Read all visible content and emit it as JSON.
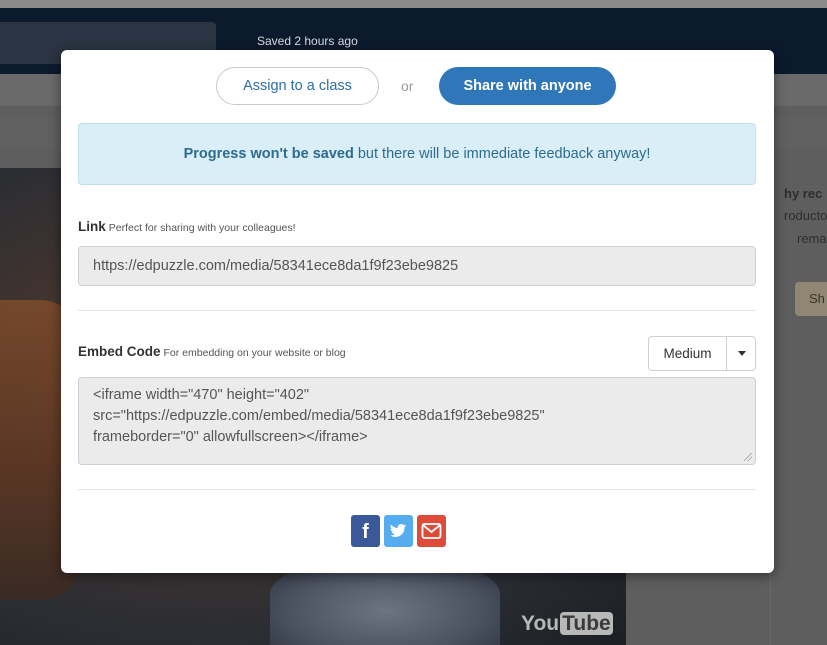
{
  "background": {
    "saved_status": "Saved 2 hours ago",
    "right_panel_lines": [
      "hy rec",
      "roducto",
      "remar"
    ],
    "right_panel_button": "Sh",
    "video_watermark_you": "You",
    "video_watermark_tube": "Tube"
  },
  "modal": {
    "tabs": {
      "assign_label": "Assign to a class",
      "or_label": "or",
      "share_label": "Share with anyone"
    },
    "alert": {
      "bold": "Progress won't be saved",
      "rest": " but there will be immediate feedback anyway!"
    },
    "link": {
      "title": "Link",
      "subtitle": "Perfect for sharing with your colleagues!",
      "value": "https://edpuzzle.com/media/58341ece8da1f9f23ebe9825"
    },
    "embed": {
      "title": "Embed Code",
      "subtitle": "For embedding on your website or blog",
      "size_selected": "Medium",
      "code": "<iframe width=\"470\" height=\"402\"\nsrc=\"https://edpuzzle.com/embed/media/58341ece8da1f9f23ebe9825\"\nframeborder=\"0\" allowfullscreen></iframe>"
    },
    "share": {
      "facebook_icon": "facebook-icon",
      "twitter_icon": "twitter-icon",
      "email_icon": "email-icon",
      "facebook_letter": "f"
    }
  },
  "colors": {
    "primary": "#2f77b9",
    "alert_bg": "#d9eef6",
    "facebook": "#3b5998",
    "twitter": "#55acee",
    "email": "#dd4b39"
  }
}
